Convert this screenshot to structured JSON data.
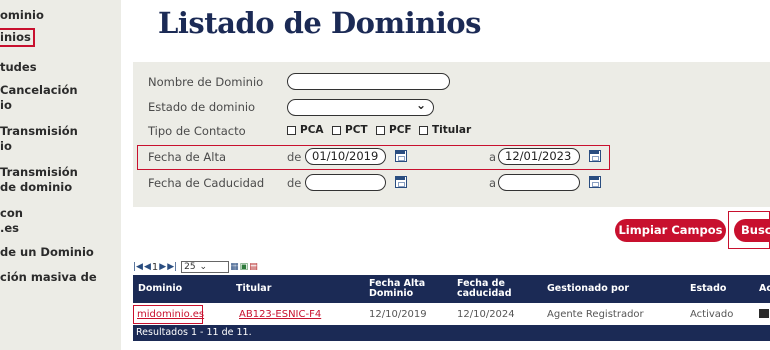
{
  "sidebar": {
    "items": [
      {
        "label": "ominio"
      },
      {
        "label": "inios"
      },
      {
        "label": "tudes"
      },
      {
        "label": "Cancelación"
      },
      {
        "label": "io"
      },
      {
        "label": "Transmisión"
      },
      {
        "label": "io"
      },
      {
        "label": "Transmisión"
      },
      {
        "label": "de dominio"
      },
      {
        "label": "con"
      },
      {
        "label": ".es"
      },
      {
        "label": "de un Dominio"
      },
      {
        "label": "ción masiva de"
      }
    ]
  },
  "page": {
    "title": "Listado de Dominios"
  },
  "filters": {
    "nombre_label": "Nombre de Dominio",
    "nombre_value": "",
    "estado_label": "Estado de dominio",
    "estado_value": "",
    "tipo_label": "Tipo de Contacto",
    "tipo_options": [
      "PCA",
      "PCT",
      "PCF",
      "Titular"
    ],
    "alta_label": "Fecha de Alta",
    "alta_de_label": "de",
    "alta_de_value": "01/10/2019",
    "alta_a_label": "a",
    "alta_a_value": "12/01/2023",
    "caducidad_label": "Fecha de Caducidad",
    "caducidad_de_label": "de",
    "caducidad_de_value": "",
    "caducidad_a_label": "a",
    "caducidad_a_value": ""
  },
  "buttons": {
    "clear_label": "Limpiar Campos",
    "search_label": "Busc"
  },
  "pager": {
    "page_number": "1",
    "page_size": "25"
  },
  "table": {
    "headers": [
      "Dominio",
      "Titular",
      "Fecha Alta Dominio",
      "Fecha de caducidad",
      "Gestionado por",
      "Estado",
      "Ac"
    ],
    "header_lines": {
      "alta_1": "Fecha Alta",
      "alta_2": "Dominio",
      "cad_1": "Fecha de",
      "cad_2": "caducidad"
    },
    "rows": [
      {
        "dominio": "midominio.es",
        "titular": "AB123-ESNIC-F4",
        "fecha_alta": "12/10/2019",
        "fecha_caducidad": "12/10/2024",
        "gestionado_por": "Agente Registrador",
        "estado": "Activado"
      }
    ],
    "footer": "Resultados 1 - 11 de 11."
  },
  "colors": {
    "accent": "#c8102e",
    "navy": "#1b2a55",
    "panel": "#ecece6"
  }
}
